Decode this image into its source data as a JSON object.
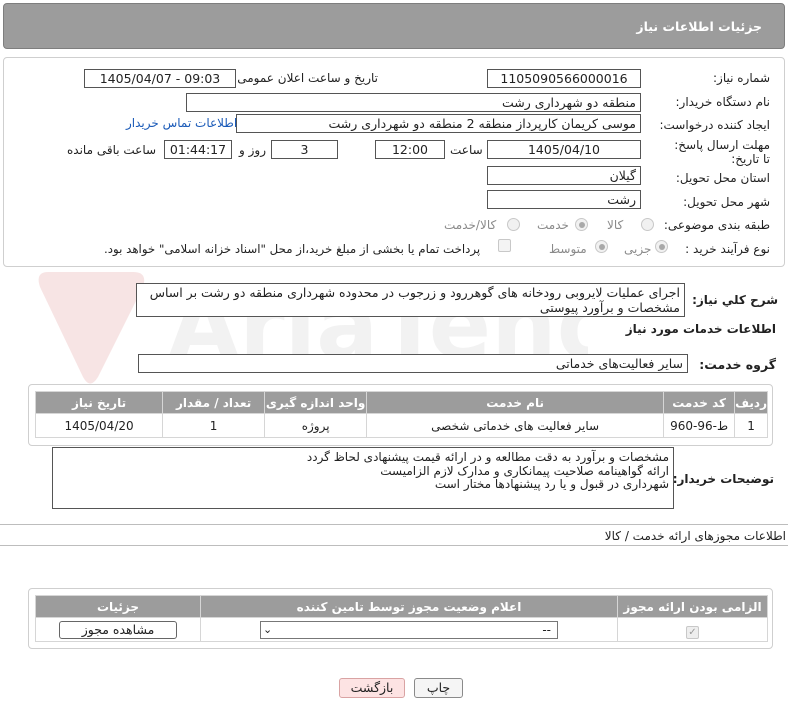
{
  "header": {
    "title": "جزئیات اطلاعات نیاز"
  },
  "form": {
    "need_number_label": "شماره نیاز:",
    "need_number": "1105090566000016",
    "announce_label": "تاریخ و ساعت اعلان عمومی:",
    "announce_value": "1405/04/07 - 09:03",
    "buyer_org_label": "نام دستگاه خریدار:",
    "buyer_org": "منطقه دو شهرداری رشت",
    "creator_label": "ایجاد کننده درخواست:",
    "creator": "موسی کریمان کارپرداز منطقه 2 منطقه دو شهرداری رشت",
    "contact_link": "اطلاعات تماس خریدار",
    "deadline_label": "مهلت ارسال پاسخ: تا تاریخ:",
    "deadline_date": "1405/04/10",
    "hour_label": "ساعت",
    "deadline_time": "12:00",
    "days": "3",
    "day_label": "روز و",
    "remaining": "01:44:17",
    "remaining_label": "ساعت باقی مانده",
    "province_label": "استان محل تحویل:",
    "province": "گیلان",
    "city_label": "شهر محل تحویل:",
    "city": "رشت",
    "category_label": "طبقه بندی موضوعی:",
    "category_options": [
      "کالا",
      "خدمت",
      "کالا/خدمت"
    ],
    "category_selected": "خدمت",
    "process_label": "نوع فرآیند خرید :",
    "process_options": [
      "جزیی",
      "متوسط"
    ],
    "process_selected": "جزیی",
    "payment_note": "پرداخت تمام یا بخشی از مبلغ خرید،از محل \"اسناد خزانه اسلامی\" خواهد بود."
  },
  "summary": {
    "label": "شرح كلي نياز:",
    "text": "اجرای عملیات لایروبی رودخانه های گوهررود و زرجوب در محدوده شهرداری منطقه دو رشت بر اساس مشخصات و برآورد پیوستی"
  },
  "services": {
    "section_title": "اطلاعات خدمات مورد نیاز",
    "group_label": "گروه خدمت:",
    "group_value": "سایر فعالیت‌های خدماتی",
    "columns": [
      "ردیف",
      "کد خدمت",
      "نام خدمت",
      "واحد اندازه گیری",
      "تعداد / مقدار",
      "تاریخ نیاز"
    ],
    "rows": [
      {
        "index": "1",
        "code": "ط-96-960",
        "name": "سایر فعالیت های خدماتی شخصی",
        "unit": "پروژه",
        "qty": "1",
        "date": "1405/04/20"
      }
    ]
  },
  "buyer_notes": {
    "label": "توضیحات خریدار:",
    "lines": [
      "مشخصات و برآورد به دقت مطالعه و در ارائه قیمت پیشنهادی لحاظ گردد",
      "ارائه گواهینامه صلاحیت پیمانکاری و مدارک لازم الزامیست",
      "شهرداری در قبول و یا رد پیشنهادها مختار است"
    ]
  },
  "permits": {
    "section_title": "اطلاعات مجوزهای ارائه خدمت / کالا",
    "columns": [
      "الزامی بودن ارائه مجوز",
      "اعلام وضعیت مجوز توسط تامین کننده",
      "جزئیات"
    ],
    "select_value": "--",
    "view_button": "مشاهده مجوز"
  },
  "footer": {
    "print_button": "چاپ",
    "back_button": "بازگشت"
  },
  "watermark": {
    "text": "AriaTender.net"
  }
}
